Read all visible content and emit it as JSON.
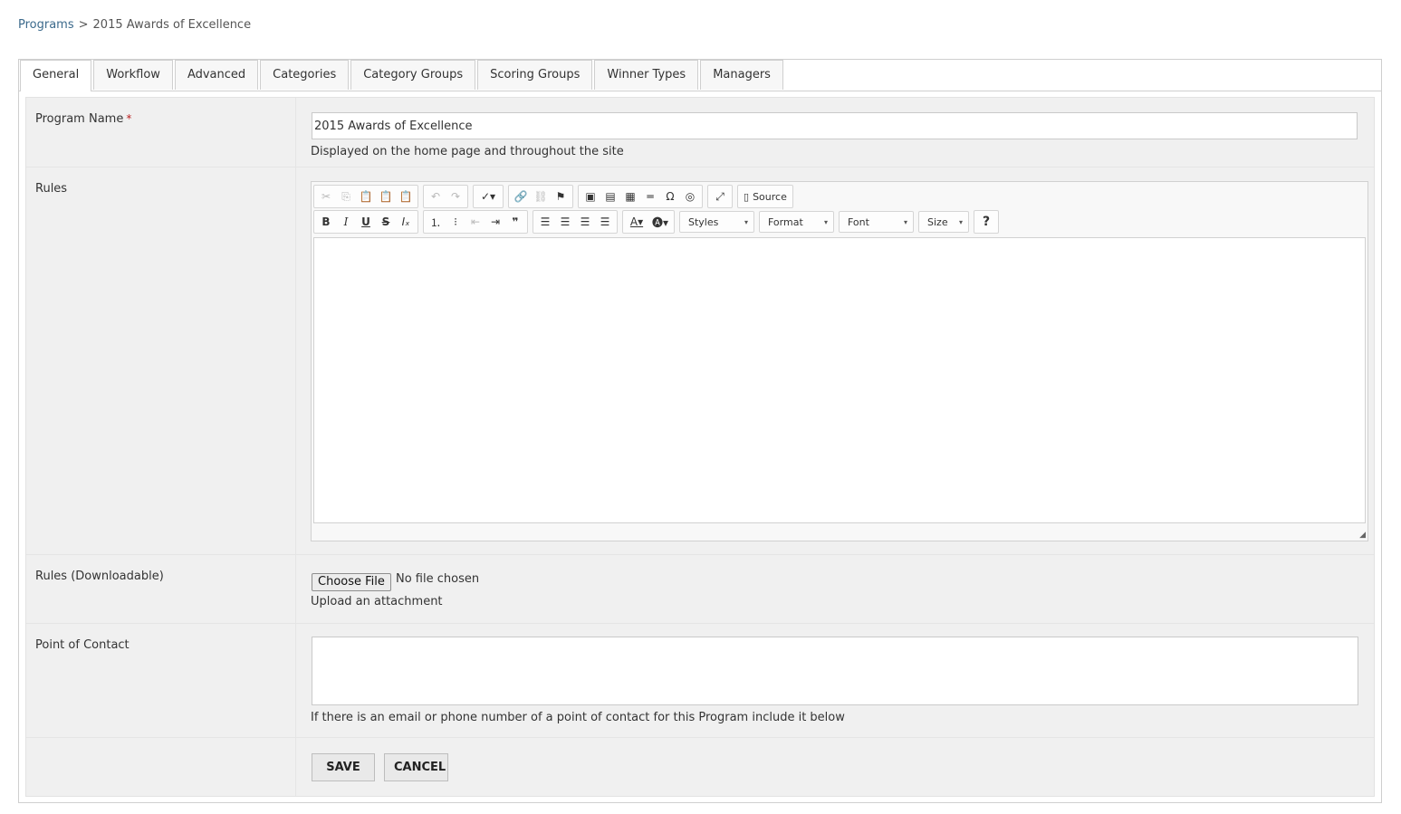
{
  "breadcrumb": {
    "root": "Programs",
    "separator": ">",
    "current": "2015 Awards of Excellence"
  },
  "tabs": [
    {
      "label": "General"
    },
    {
      "label": "Workflow"
    },
    {
      "label": "Advanced"
    },
    {
      "label": "Categories"
    },
    {
      "label": "Category Groups"
    },
    {
      "label": "Scoring Groups"
    },
    {
      "label": "Winner Types"
    },
    {
      "label": "Managers"
    }
  ],
  "fields": {
    "program_name": {
      "label": "Program Name",
      "required_mark": "*",
      "value": "2015 Awards of Excellence",
      "help": "Displayed on the home page and throughout the site"
    },
    "rules": {
      "label": "Rules",
      "toolbar": {
        "source_label": "Source",
        "styles": "Styles",
        "format": "Format",
        "font": "Font",
        "size": "Size",
        "help": "?"
      }
    },
    "rules_download": {
      "label": "Rules (Downloadable)",
      "choose_label": "Choose File",
      "status": "No file chosen",
      "help": "Upload an attachment"
    },
    "point_of_contact": {
      "label": "Point of Contact",
      "value": "",
      "help": "If there is an email or phone number of a point of contact for this Program include it below"
    }
  },
  "actions": {
    "save": "SAVE",
    "cancel": "CANCEL"
  },
  "colors": {
    "link": "#3c6a8c",
    "required": "#bb2222",
    "form_bg": "#f0f0f0"
  }
}
